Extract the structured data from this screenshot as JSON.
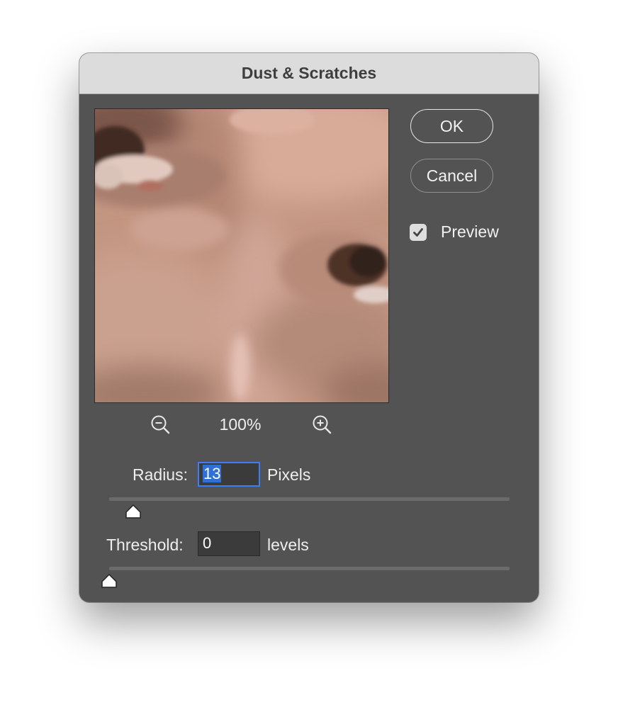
{
  "dialog": {
    "title": "Dust & Scratches"
  },
  "buttons": {
    "ok_label": "OK",
    "cancel_label": "Cancel"
  },
  "preview_toggle": {
    "label": "Preview",
    "checked": true
  },
  "zoom": {
    "level": "100%"
  },
  "radius": {
    "label": "Radius:",
    "value": "13",
    "unit": "Pixels",
    "slider_fraction": 0.06
  },
  "threshold": {
    "label": "Threshold:",
    "value": "0",
    "unit": "levels",
    "slider_fraction": 0.0
  },
  "icons": [
    "zoom-out-icon",
    "zoom-in-icon",
    "checkmark-icon"
  ],
  "colors": {
    "dialog_bg": "#535353",
    "titlebar_bg": "#dcdcdc",
    "focus": "#3d7ff2",
    "selection": "#2f6fd6"
  }
}
